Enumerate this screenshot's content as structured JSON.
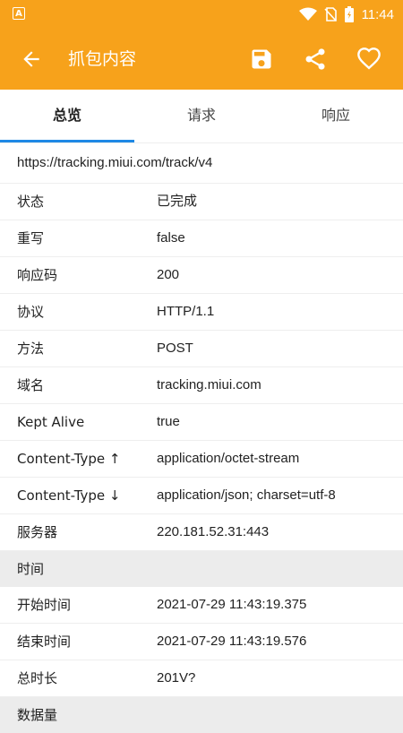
{
  "status_bar": {
    "time": "11:44",
    "notification_icon": "A"
  },
  "app_bar": {
    "title": "抓包内容"
  },
  "tabs": [
    {
      "label": "总览",
      "active": true
    },
    {
      "label": "请求",
      "active": false
    },
    {
      "label": "响应",
      "active": false
    }
  ],
  "url": "https://tracking.miui.com/track/v4",
  "overview_rows": [
    {
      "key": "状态",
      "value": "已完成"
    },
    {
      "key": "重写",
      "value": "false"
    },
    {
      "key": "响应码",
      "value": "200"
    },
    {
      "key": "协议",
      "value": "HTTP/1.1"
    },
    {
      "key": "方法",
      "value": "POST"
    },
    {
      "key": "域名",
      "value": "tracking.miui.com"
    },
    {
      "key": "Kept Alive",
      "value": "true"
    },
    {
      "key": "Content-Type ↑",
      "value": "application/octet-stream"
    },
    {
      "key": "Content-Type ↓",
      "value": "application/json; charset=utf-8"
    },
    {
      "key": "服务器",
      "value": "220.181.52.31:443"
    }
  ],
  "time_section": {
    "header": "时间",
    "rows": [
      {
        "key": "开始时间",
        "value": "2021-07-29 11:43:19.375"
      },
      {
        "key": "结束时间",
        "value": "2021-07-29 11:43:19.576"
      },
      {
        "key": "总时长",
        "value": "201V?"
      }
    ]
  },
  "data_section": {
    "header": "数据量"
  },
  "colors": {
    "accent": "#f7a21b",
    "tab_indicator": "#1e88e5",
    "section_bg": "#ececec"
  }
}
